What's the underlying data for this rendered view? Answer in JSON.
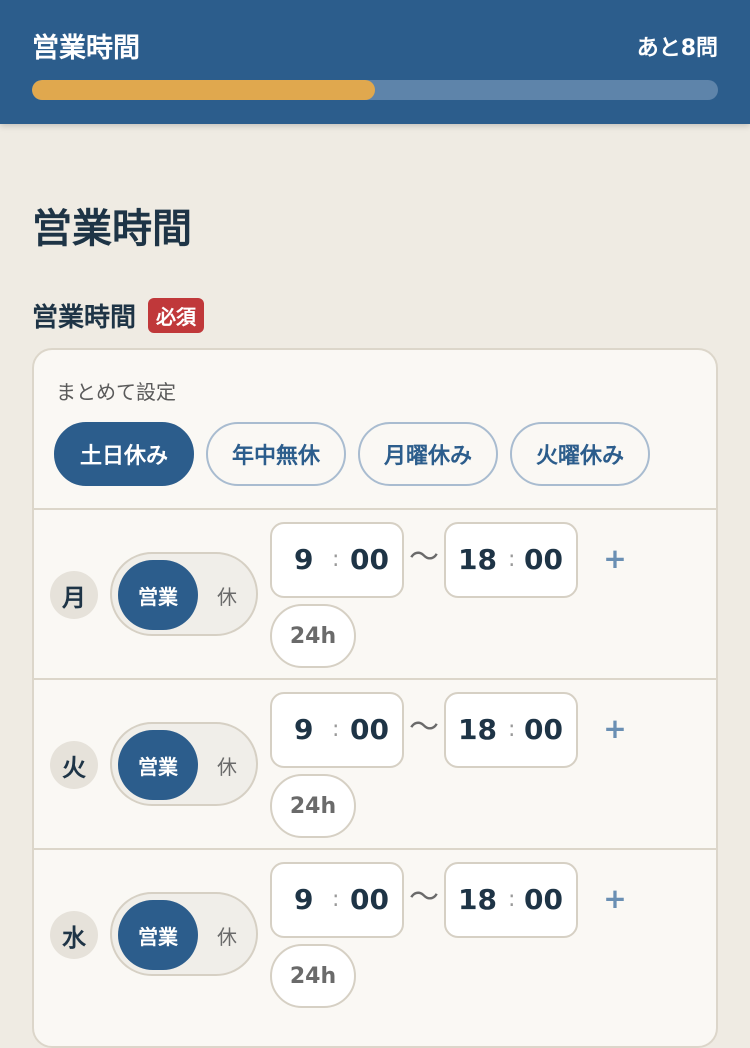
{
  "header": {
    "title": "営業時間",
    "remaining": "あと8問",
    "progress": 0.5
  },
  "page": {
    "title": "営業時間"
  },
  "field": {
    "label": "営業時間",
    "required": "必須"
  },
  "bulk": {
    "label": "まとめて設定",
    "presets": [
      {
        "label": "土日休み",
        "active": true
      },
      {
        "label": "年中無休",
        "active": false
      },
      {
        "label": "月曜休み",
        "active": false
      },
      {
        "label": "火曜休み",
        "active": false
      }
    ]
  },
  "days": [
    {
      "day": "月",
      "open": "営業",
      "closed": "休",
      "start_h": "9",
      "start_m": "00",
      "end_h": "18",
      "end_m": "00",
      "sep": ":",
      "tilde": "〜",
      "add": "+",
      "h24": "24h"
    },
    {
      "day": "火",
      "open": "営業",
      "closed": "休",
      "start_h": "9",
      "start_m": "00",
      "end_h": "18",
      "end_m": "00",
      "sep": ":",
      "tilde": "〜",
      "add": "+",
      "h24": "24h"
    },
    {
      "day": "水",
      "open": "営業",
      "closed": "休",
      "start_h": "9",
      "start_m": "00",
      "end_h": "18",
      "end_m": "00",
      "sep": ":",
      "tilde": "〜",
      "add": "+",
      "h24": "24h"
    }
  ],
  "colors": {
    "primary": "#2c5d8c",
    "accent": "#e0a84e",
    "required": "#c0383a",
    "background": "#efebe3"
  }
}
